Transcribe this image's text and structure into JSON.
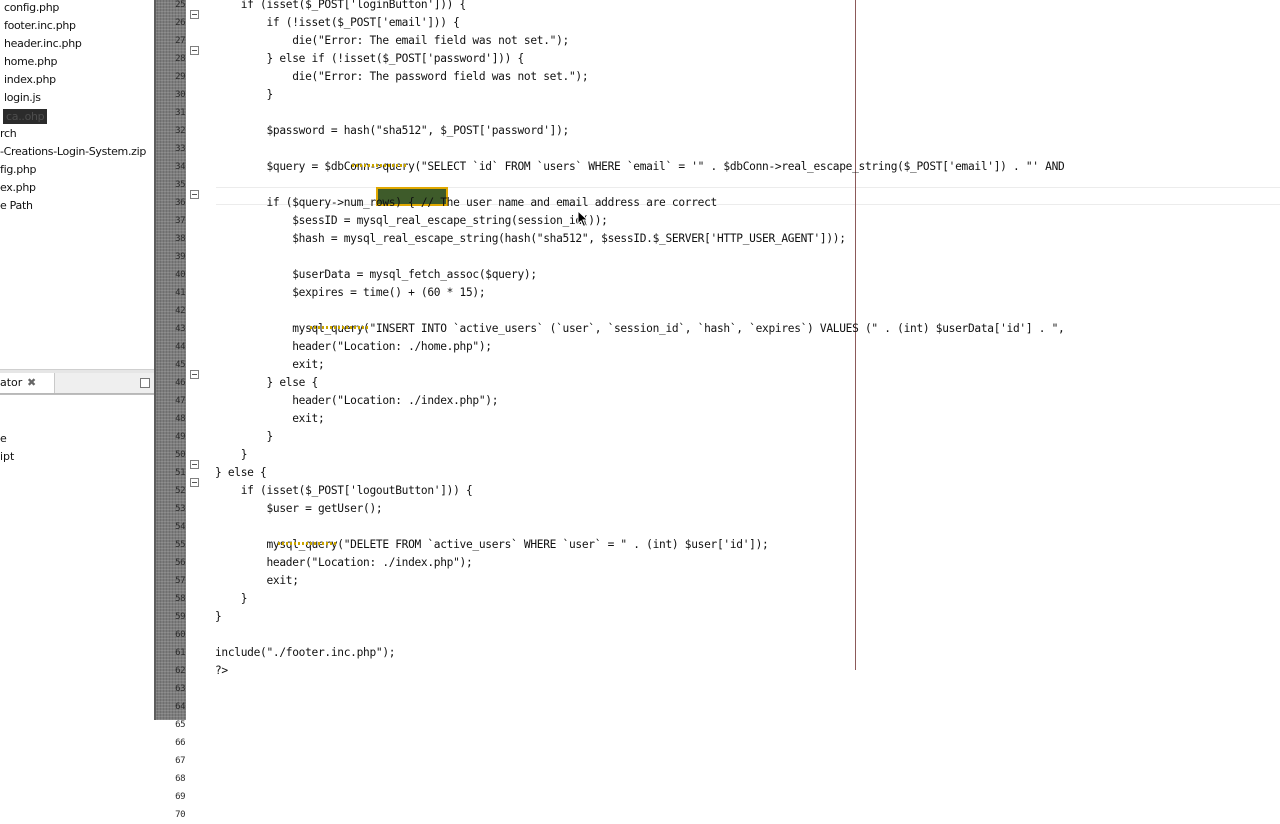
{
  "sidebar": {
    "files": [
      "config.php",
      "footer.inc.php",
      "header.inc.php",
      "home.php",
      "index.php",
      "login.js"
    ],
    "selected_file": "ca..ohp",
    "tree_rest": [
      "rch",
      "-Creations-Login-System.zip",
      "fig.php",
      "ex.php",
      "e Path"
    ],
    "panel2_title": "ator",
    "panel2_close": "✖",
    "panel2_items": [
      "e",
      "ipt"
    ]
  },
  "line_numbers": [
    "25",
    "26",
    "27",
    "28",
    "29",
    "30",
    "31",
    "32",
    "33",
    "34",
    "35",
    "36",
    "37",
    "38",
    "39",
    "40",
    "41",
    "42",
    "43",
    "44",
    "45",
    "46",
    "47",
    "48",
    "49",
    "50",
    "51",
    "52",
    "53",
    "54",
    "55",
    "56",
    "57",
    "58",
    "59",
    "60",
    "61",
    "62",
    "63",
    "64",
    "65",
    "66",
    "67",
    "68",
    "69",
    "70"
  ],
  "code_lines": [
    "    if (isset($_POST['loginButton'])) {",
    "        if (!isset($_POST['email'])) {",
    "            die(\"Error: The email field was not set.\");",
    "        } else if (!isset($_POST['password'])) {",
    "            die(\"Error: The password field was not set.\");",
    "        }",
    "",
    "        $password = hash(\"sha512\", $_POST['password']);",
    "",
    "        $query = $dbConn->query(\"SELECT `id` FROM `users` WHERE `email` = '\" . $dbConn->real_escape_string($_POST['email']) . \"' AND",
    "",
    "        if ($query->num_rows) { // The user name and email address are correct",
    "            $sessID = mysql_real_escape_string(session_id());",
    "            $hash = mysql_real_escape_string(hash(\"sha512\", $sessID.$_SERVER['HTTP_USER_AGENT']));",
    "",
    "            $userData = mysql_fetch_assoc($query);",
    "            $expires = time() + (60 * 15);",
    "",
    "            mysql_query(\"INSERT INTO `active_users` (`user`, `session_id`, `hash`, `expires`) VALUES (\" . (int) $userData['id'] . \",",
    "            header(\"Location: ./home.php\");",
    "            exit;",
    "        } else {",
    "            header(\"Location: ./index.php\");",
    "            exit;",
    "        }",
    "    }",
    "} else {",
    "    if (isset($_POST['logoutButton'])) {",
    "        $user = getUser();",
    "",
    "        mysql_query(\"DELETE FROM `active_users` WHERE `user` = \" . (int) $user['id']);",
    "        header(\"Location: ./index.php\");",
    "        exit;",
    "    }",
    "}",
    "",
    "include(\"./footer.inc.php\");",
    "?>"
  ]
}
